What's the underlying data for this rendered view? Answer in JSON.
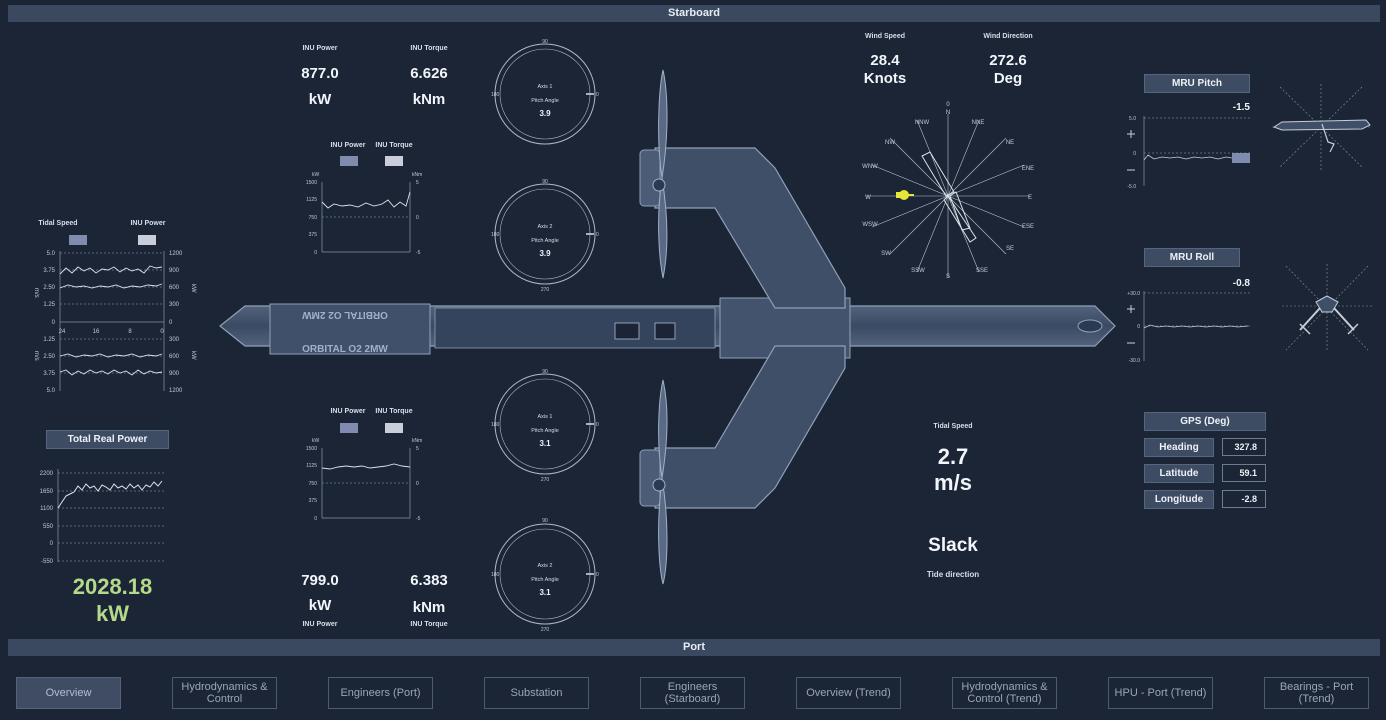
{
  "bars": {
    "starboard": "Starboard",
    "port": "Port"
  },
  "starboard_inu": {
    "power_label": "INU Power",
    "torque_label": "INU Torque",
    "power_value": "877.0",
    "torque_value": "6.626",
    "power_unit": "kW",
    "torque_unit": "kNm"
  },
  "port_inu": {
    "power_label": "INU Power",
    "torque_label": "INU Torque",
    "power_value": "799.0",
    "torque_value": "6.383",
    "power_unit": "kW",
    "torque_unit": "kNm"
  },
  "inu_chart_top": {
    "legend_power": "INU Power",
    "legend_torque": "INU Torque",
    "unit_left": "kW",
    "unit_right": "kNm",
    "left_ticks": [
      "1500",
      "1125",
      "750",
      "375",
      "0"
    ],
    "right_ticks": [
      "5",
      "0",
      "-5"
    ],
    "power_color": "#7f8cb0",
    "torque_color": "#c9ced8"
  },
  "inu_chart_bottom": {
    "legend_power": "INU Power",
    "legend_torque": "INU Torque",
    "unit_left": "kW",
    "unit_right": "kNm",
    "left_ticks": [
      "1500",
      "1125",
      "750",
      "375",
      "0"
    ],
    "right_ticks": [
      "5",
      "0",
      "-5"
    ]
  },
  "dual_chart": {
    "legend_tidal": "Tidal Speed",
    "legend_inu": "INU Power",
    "left_unit": "m/s",
    "right_unit": "kW",
    "left_top_ticks": [
      "5.0",
      "3.75",
      "2.50",
      "1.25",
      "0"
    ],
    "left_bottom_ticks": [
      "1.25",
      "2.50",
      "3.75",
      "5.0"
    ],
    "right_top_ticks": [
      "1200",
      "900",
      "600",
      "300",
      "0"
    ],
    "right_bottom_ticks": [
      "300",
      "600",
      "900",
      "1200"
    ],
    "x_ticks": [
      "24",
      "16",
      "8",
      "0"
    ]
  },
  "total_power": {
    "title": "Total Real Power",
    "ticks": [
      "2200",
      "1650",
      "1100",
      "550",
      "0",
      "-550"
    ],
    "value": "2028.18",
    "unit": "kW",
    "value_color": "#b5d98a"
  },
  "dials": [
    {
      "axis": "Axis 1",
      "label": "Pitch Angle",
      "value": "3.9",
      "top": "90",
      "left": "180",
      "bottom": "270",
      "right": "0"
    },
    {
      "axis": "Axis 2",
      "label": "Pitch Angle",
      "value": "3.9",
      "top": "90",
      "left": "180",
      "bottom": "270",
      "right": "0"
    },
    {
      "axis": "Axis 1",
      "label": "Pitch Angle",
      "value": "3.1",
      "top": "90",
      "left": "180",
      "bottom": "270",
      "right": "0"
    },
    {
      "axis": "Axis 2",
      "label": "Pitch Angle",
      "value": "3.1",
      "top": "90",
      "left": "180",
      "bottom": "270",
      "right": "0"
    }
  ],
  "vessel": {
    "name_text": "ORBITAL O2 2MW"
  },
  "wind": {
    "speed_label": "Wind Speed",
    "speed_value": "28.4",
    "speed_unit": "Knots",
    "direction_label": "Wind Direction",
    "direction_value": "272.6",
    "direction_unit": "Deg",
    "compass": [
      "0",
      "N",
      "NNE",
      "NE",
      "ENE",
      "E",
      "ESE",
      "SE",
      "SSE",
      "S",
      "SSW",
      "SW",
      "WSW",
      "W",
      "WNW",
      "NW",
      "NNW"
    ],
    "marker_color": "#e5e53a"
  },
  "tidal": {
    "label": "Tidal Speed",
    "value": "2.7",
    "unit": "m/s",
    "tide": "Slack",
    "tide_label": "Tide direction"
  },
  "mru_pitch": {
    "title": "MRU Pitch",
    "value": "-1.5",
    "ticks": [
      "5.0",
      "0",
      "-5.0"
    ]
  },
  "mru_roll": {
    "title": "MRU Roll",
    "value": "-0.8",
    "ticks": [
      "+30.0",
      "0",
      "-30.0"
    ]
  },
  "gps": {
    "title": "GPS (Deg)",
    "rows": [
      {
        "label": "Heading",
        "value": "327.8"
      },
      {
        "label": "Latitude",
        "value": "59.1"
      },
      {
        "label": "Longitude",
        "value": "-2.8"
      }
    ]
  },
  "nav": [
    "Overview",
    "Hydrodynamics & Control",
    "Engineers (Port)",
    "Substation",
    "Engineers (Starboard)",
    "Overview (Trend)",
    "Hydrodynamics & Control (Trend)",
    "HPU - Port (Trend)",
    "Bearings - Port (Trend)"
  ]
}
